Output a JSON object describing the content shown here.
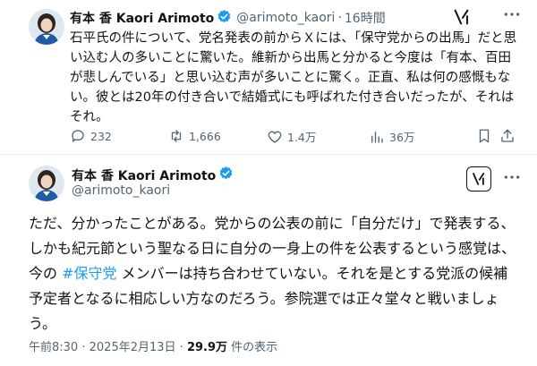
{
  "tweet1": {
    "display_name": "有本 香 Kaori Arimoto",
    "handle": "@arimoto_kaori",
    "separator": "·",
    "time": "16時間",
    "text": "石平氏の件について、党名発表の前からＸには、「保守党からの出馬」だと思い込む人の多いことに驚いた。維新から出馬と分かると今度は「有本、百田が悲しんでいる」と思い込む声が多いことに驚く。正直、私は何の感慨もない。彼とは20年の付き合いで結婚式にも呼ばれた付き合いだったが、それはそれ。",
    "replies": "232",
    "retweets": "1,666",
    "likes": "1.4万",
    "views": "36万"
  },
  "tweet2": {
    "display_name": "有本 香 Kaori Arimoto",
    "handle": "@arimoto_kaori",
    "text_before": "ただ、分かったことがある。党からの公表の前に「自分だけ」で発表する、しかも紀元節という聖なる日に自分の一身上の件を公表するという感覚は、 今の ",
    "hashtag": "#保守党",
    "text_after": " メンバーは持ち合わせていない。それを是とする党派の候補予定者となるに相応しい方なのだろう。参院選では正々堂々と戦いましょう。",
    "time": "午前8:30",
    "date_separator": "·",
    "date": "2025年2月13日",
    "views_count": "29.9万",
    "views_label": "件の表示"
  },
  "colors": {
    "verified": "#1d9bf0",
    "hashtag": "#1d9bf0",
    "secondary_text": "#536471"
  },
  "icons": [
    "verified-badge-icon",
    "grok-icon",
    "more-icon",
    "reply-icon",
    "retweet-icon",
    "like-icon",
    "views-icon",
    "bookmark-icon",
    "share-icon"
  ]
}
